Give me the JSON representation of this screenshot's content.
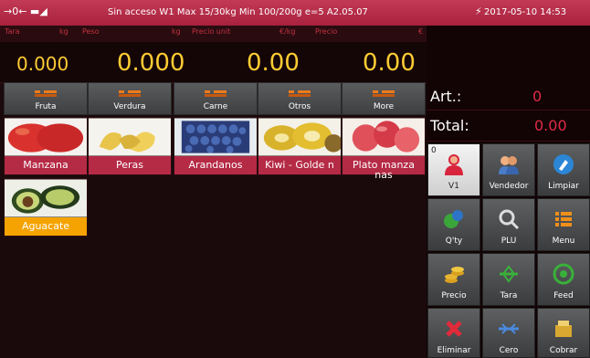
{
  "status": {
    "icons_left": "connection-icons",
    "text": "Sin acceso  W1  Max 15/30kg Min 100/200g e=5  A2.05.07",
    "datetime": "2017-05-10 14:53"
  },
  "labels": {
    "tara": "Tara",
    "kg1": "kg",
    "peso": "Peso",
    "kg2": "kg",
    "precio_unit": "Precio unit",
    "ekg": "€/kg",
    "precio": "Precio",
    "euro": "€"
  },
  "display": {
    "tara": "0.000",
    "peso": "0.000",
    "precio_unit": "0.00",
    "precio": "0.00"
  },
  "categories": [
    "Fruta",
    "Verdura",
    "Carne",
    "Otros",
    "More"
  ],
  "products": [
    {
      "name": "Manzana"
    },
    {
      "name": "Peras"
    },
    {
      "name": "Arandanos"
    },
    {
      "name": "Kiwi - Golde n"
    },
    {
      "name": "Plato manza nas"
    },
    {
      "name": "Aguacate"
    }
  ],
  "summary": {
    "art_label": "Art.:",
    "art_value": "0",
    "total_label": "Total:",
    "total_value": "0.00"
  },
  "buttons": [
    {
      "label": "V1",
      "icon": "user-icon",
      "badge": "0"
    },
    {
      "label": "Vendedor",
      "icon": "vendors-icon"
    },
    {
      "label": "Limpiar",
      "icon": "clean-icon"
    },
    {
      "label": "Q'ty",
      "icon": "quantity-icon"
    },
    {
      "label": "PLU",
      "icon": "plu-search-icon"
    },
    {
      "label": "Menu",
      "icon": "menu-icon"
    },
    {
      "label": "Precio",
      "icon": "coins-icon"
    },
    {
      "label": "Tara",
      "icon": "tare-icon"
    },
    {
      "label": "Feed",
      "icon": "feed-icon"
    },
    {
      "label": "Eliminar",
      "icon": "delete-icon"
    },
    {
      "label": "Cero",
      "icon": "zero-icon"
    },
    {
      "label": "Cobrar",
      "icon": "cash-icon"
    }
  ],
  "colors": {
    "accent": "#b52a45",
    "display_digits": "#ffcc33",
    "total_value": "#e02a44"
  }
}
